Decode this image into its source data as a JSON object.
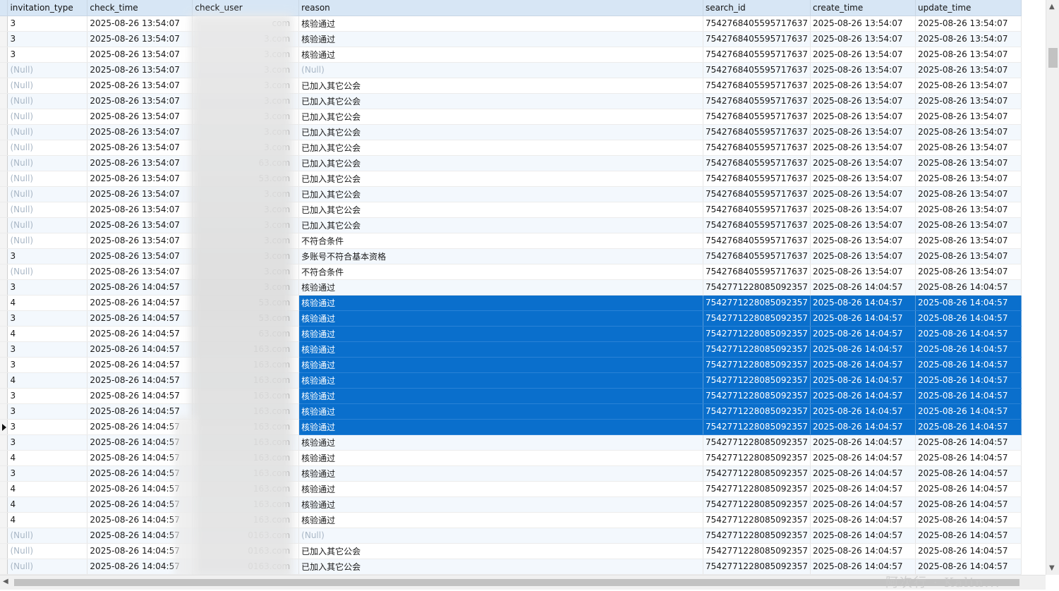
{
  "columns": [
    "invitation_type",
    "check_time",
    "check_user",
    "reason",
    "search_id",
    "create_time",
    "update_time"
  ],
  "rows": [
    [
      "3",
      "2025-08-26 13:54:07",
      "com",
      "核验通过",
      "7542768405595717637",
      "2025-08-26 13:54:07",
      "2025-08-26 13:54:07"
    ],
    [
      "3",
      "2025-08-26 13:54:07",
      "3.com",
      "核验通过",
      "7542768405595717637",
      "2025-08-26 13:54:07",
      "2025-08-26 13:54:07"
    ],
    [
      "3",
      "2025-08-26 13:54:07",
      "3.com",
      "核验通过",
      "7542768405595717637",
      "2025-08-26 13:54:07",
      "2025-08-26 13:54:07"
    ],
    [
      "(Null)",
      "2025-08-26 13:54:07",
      "3.com",
      "(Null)",
      "7542768405595717637",
      "2025-08-26 13:54:07",
      "2025-08-26 13:54:07"
    ],
    [
      "(Null)",
      "2025-08-26 13:54:07",
      "3.com",
      "已加入其它公会",
      "7542768405595717637",
      "2025-08-26 13:54:07",
      "2025-08-26 13:54:07"
    ],
    [
      "(Null)",
      "2025-08-26 13:54:07",
      "3.com",
      "已加入其它公会",
      "7542768405595717637",
      "2025-08-26 13:54:07",
      "2025-08-26 13:54:07"
    ],
    [
      "(Null)",
      "2025-08-26 13:54:07",
      "3.com",
      "已加入其它公会",
      "7542768405595717637",
      "2025-08-26 13:54:07",
      "2025-08-26 13:54:07"
    ],
    [
      "(Null)",
      "2025-08-26 13:54:07",
      "3.com",
      "已加入其它公会",
      "7542768405595717637",
      "2025-08-26 13:54:07",
      "2025-08-26 13:54:07"
    ],
    [
      "(Null)",
      "2025-08-26 13:54:07",
      "3.com",
      "已加入其它公会",
      "7542768405595717637",
      "2025-08-26 13:54:07",
      "2025-08-26 13:54:07"
    ],
    [
      "(Null)",
      "2025-08-26 13:54:07",
      "63.com",
      "已加入其它公会",
      "7542768405595717637",
      "2025-08-26 13:54:07",
      "2025-08-26 13:54:07"
    ],
    [
      "(Null)",
      "2025-08-26 13:54:07",
      "53.com",
      "已加入其它公会",
      "7542768405595717637",
      "2025-08-26 13:54:07",
      "2025-08-26 13:54:07"
    ],
    [
      "(Null)",
      "2025-08-26 13:54:07",
      "3.com",
      "已加入其它公会",
      "7542768405595717637",
      "2025-08-26 13:54:07",
      "2025-08-26 13:54:07"
    ],
    [
      "(Null)",
      "2025-08-26 13:54:07",
      "3.com",
      "已加入其它公会",
      "7542768405595717637",
      "2025-08-26 13:54:07",
      "2025-08-26 13:54:07"
    ],
    [
      "(Null)",
      "2025-08-26 13:54:07",
      "3.com",
      "已加入其它公会",
      "7542768405595717637",
      "2025-08-26 13:54:07",
      "2025-08-26 13:54:07"
    ],
    [
      "(Null)",
      "2025-08-26 13:54:07",
      "3.com",
      "不符合条件",
      "7542768405595717637",
      "2025-08-26 13:54:07",
      "2025-08-26 13:54:07"
    ],
    [
      "3",
      "2025-08-26 13:54:07",
      "3.com",
      "多账号不符合基本资格",
      "7542768405595717637",
      "2025-08-26 13:54:07",
      "2025-08-26 13:54:07"
    ],
    [
      "(Null)",
      "2025-08-26 13:54:07",
      "3.com",
      "不符合条件",
      "7542768405595717637",
      "2025-08-26 13:54:07",
      "2025-08-26 13:54:07"
    ],
    [
      "3",
      "2025-08-26 14:04:57",
      "3.com",
      "核验通过",
      "7542771228085092357",
      "2025-08-26 14:04:57",
      "2025-08-26 14:04:57"
    ],
    [
      "4",
      "2025-08-26 14:04:57",
      "53.com",
      "核验通过",
      "7542771228085092357",
      "2025-08-26 14:04:57",
      "2025-08-26 14:04:57"
    ],
    [
      "3",
      "2025-08-26 14:04:57",
      "53.com",
      "核验通过",
      "7542771228085092357",
      "2025-08-26 14:04:57",
      "2025-08-26 14:04:57"
    ],
    [
      "4",
      "2025-08-26 14:04:57",
      "63.com",
      "核验通过",
      "7542771228085092357",
      "2025-08-26 14:04:57",
      "2025-08-26 14:04:57"
    ],
    [
      "3",
      "2025-08-26 14:04:57",
      "163.com",
      "核验通过",
      "7542771228085092357",
      "2025-08-26 14:04:57",
      "2025-08-26 14:04:57"
    ],
    [
      "3",
      "2025-08-26 14:04:57",
      "163.com",
      "核验通过",
      "7542771228085092357",
      "2025-08-26 14:04:57",
      "2025-08-26 14:04:57"
    ],
    [
      "4",
      "2025-08-26 14:04:57",
      "163.com",
      "核验通过",
      "7542771228085092357",
      "2025-08-26 14:04:57",
      "2025-08-26 14:04:57"
    ],
    [
      "3",
      "2025-08-26 14:04:57",
      "163.com",
      "核验通过",
      "7542771228085092357",
      "2025-08-26 14:04:57",
      "2025-08-26 14:04:57"
    ],
    [
      "3",
      "2025-08-26 14:04:57",
      "163.com",
      "核验通过",
      "7542771228085092357",
      "2025-08-26 14:04:57",
      "2025-08-26 14:04:57"
    ],
    [
      "3",
      "2025-08-26 14:04:57",
      "163.com",
      "核验通过",
      "7542771228085092357",
      "2025-08-26 14:04:57",
      "2025-08-26 14:04:57"
    ],
    [
      "3",
      "2025-08-26 14:04:57",
      "163.com",
      "核验通过",
      "7542771228085092357",
      "2025-08-26 14:04:57",
      "2025-08-26 14:04:57"
    ],
    [
      "4",
      "2025-08-26 14:04:57",
      "163.com",
      "核验通过",
      "7542771228085092357",
      "2025-08-26 14:04:57",
      "2025-08-26 14:04:57"
    ],
    [
      "3",
      "2025-08-26 14:04:57",
      "163.com",
      "核验通过",
      "7542771228085092357",
      "2025-08-26 14:04:57",
      "2025-08-26 14:04:57"
    ],
    [
      "4",
      "2025-08-26 14:04:57",
      "163.com",
      "核验通过",
      "7542771228085092357",
      "2025-08-26 14:04:57",
      "2025-08-26 14:04:57"
    ],
    [
      "4",
      "2025-08-26 14:04:57",
      "163.com",
      "核验通过",
      "7542771228085092357",
      "2025-08-26 14:04:57",
      "2025-08-26 14:04:57"
    ],
    [
      "4",
      "2025-08-26 14:04:57",
      "163.com",
      "核验通过",
      "7542771228085092357",
      "2025-08-26 14:04:57",
      "2025-08-26 14:04:57"
    ],
    [
      "(Null)",
      "2025-08-26 14:04:57",
      "0163.com",
      "(Null)",
      "7542771228085092357",
      "2025-08-26 14:04:57",
      "2025-08-26 14:04:57"
    ],
    [
      "(Null)",
      "2025-08-26 14:04:57",
      "0163.com",
      "已加入其它公会",
      "7542771228085092357",
      "2025-08-26 14:04:57",
      "2025-08-26 14:04:57"
    ],
    [
      "(Null)",
      "2025-08-26 14:04:57",
      "0163.com",
      "已加入其它公会",
      "7542771228085092357",
      "2025-08-26 14:04:57",
      "2025-08-26 14:04:57"
    ]
  ],
  "selected_rows": [
    18,
    19,
    20,
    21,
    22,
    23,
    24,
    25,
    26
  ],
  "current_row": 26,
  "null_text": "(Null)",
  "watermark": "阿次行 · Kalin..."
}
